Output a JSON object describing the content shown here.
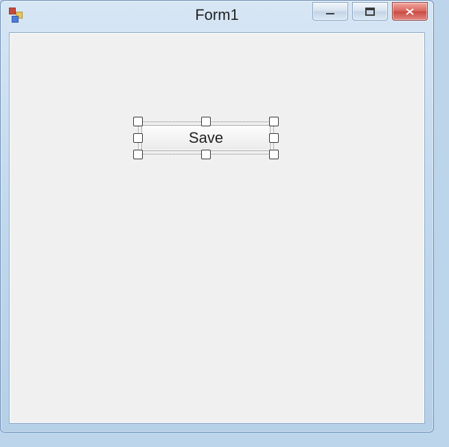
{
  "window": {
    "title": "Form1"
  },
  "designer": {
    "selected_control": {
      "type": "Button",
      "text": "Save"
    }
  }
}
